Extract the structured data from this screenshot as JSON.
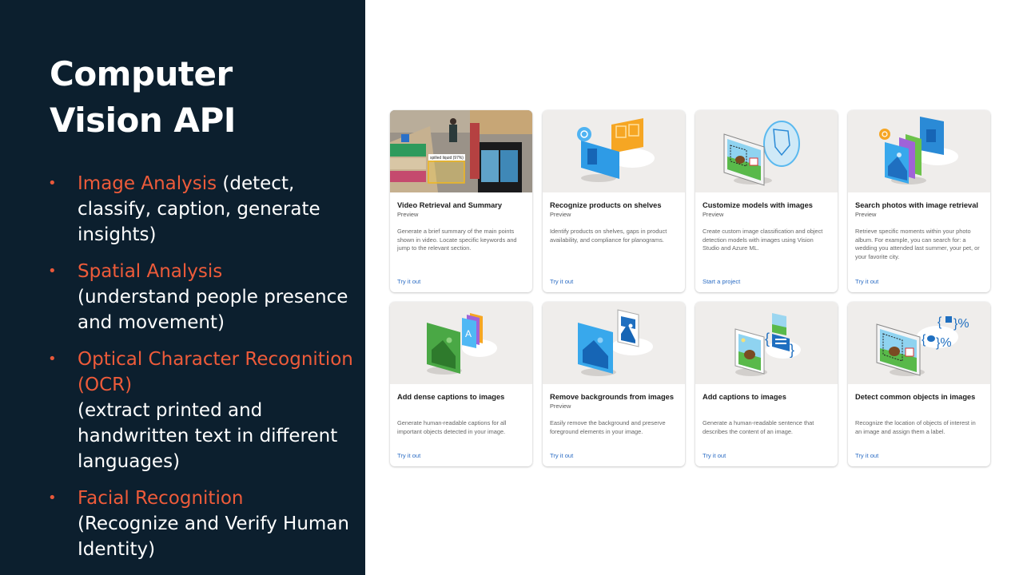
{
  "slide": {
    "title_line1": "Computer",
    "title_line2": "Vision API",
    "bullet_glyph": "•",
    "bullets": [
      {
        "highlight": "Image Analysis",
        "text": " (detect, classify, caption, generate insights)"
      },
      {
        "highlight": "Spatial Analysis",
        "text": " (understand people presence and movement)"
      },
      {
        "highlight": "Optical Character Recognition (OCR)",
        "text": " (extract printed and handwritten text in different languages)"
      },
      {
        "highlight": "Facial Recognition",
        "text": " (Recognize and Verify Human Identity)"
      }
    ]
  },
  "colors": {
    "panel_bg": "#0c1f2e",
    "highlight": "#ee5b3a",
    "link": "#2b6cc4",
    "thumb_bg": "#efedeb"
  },
  "cards": [
    {
      "title": "Video Retrieval and Summary",
      "subtitle": "Preview",
      "description": "Generate a brief summary of the main points shown in video. Locate specific keywords and jump to the relevant section.",
      "action": "Try it out",
      "image": "store-video-photo",
      "overlay_label": "spilled liquid (97%)"
    },
    {
      "title": "Recognize products on shelves",
      "subtitle": "Preview",
      "description": "Identify products on shelves, gaps in product availability, and compliance for planograms.",
      "action": "Try it out",
      "image": "shelf-recognition-illustration"
    },
    {
      "title": "Customize models with images",
      "subtitle": "Preview",
      "description": "Create custom image classification and object detection models with images using Vision Studio and Azure ML.",
      "action": "Start a project",
      "image": "custom-model-illustration"
    },
    {
      "title": "Search photos with image retrieval",
      "subtitle": "Preview",
      "description": "Retrieve specific moments within your photo album. For example, you can search for: a wedding you attended last summer, your pet, or your favorite city.",
      "action": "Try it out",
      "image": "photo-search-illustration"
    },
    {
      "title": "Add dense captions to images",
      "subtitle": "",
      "description": "Generate human-readable captions for all important objects detected in your image.",
      "action": "Try it out",
      "image": "dense-captions-illustration"
    },
    {
      "title": "Remove backgrounds from images",
      "subtitle": "Preview",
      "description": "Easily remove the background and preserve foreground elements in your image.",
      "action": "Try it out",
      "image": "background-removal-illustration"
    },
    {
      "title": "Add captions to images",
      "subtitle": "",
      "description": "Generate a human-readable sentence that describes the content of an image.",
      "action": "Try it out",
      "image": "captions-illustration"
    },
    {
      "title": "Detect common objects in images",
      "subtitle": "",
      "description": "Recognize the location of objects of interest in an image and assign them a label.",
      "action": "Try it out",
      "image": "object-detection-illustration"
    }
  ]
}
